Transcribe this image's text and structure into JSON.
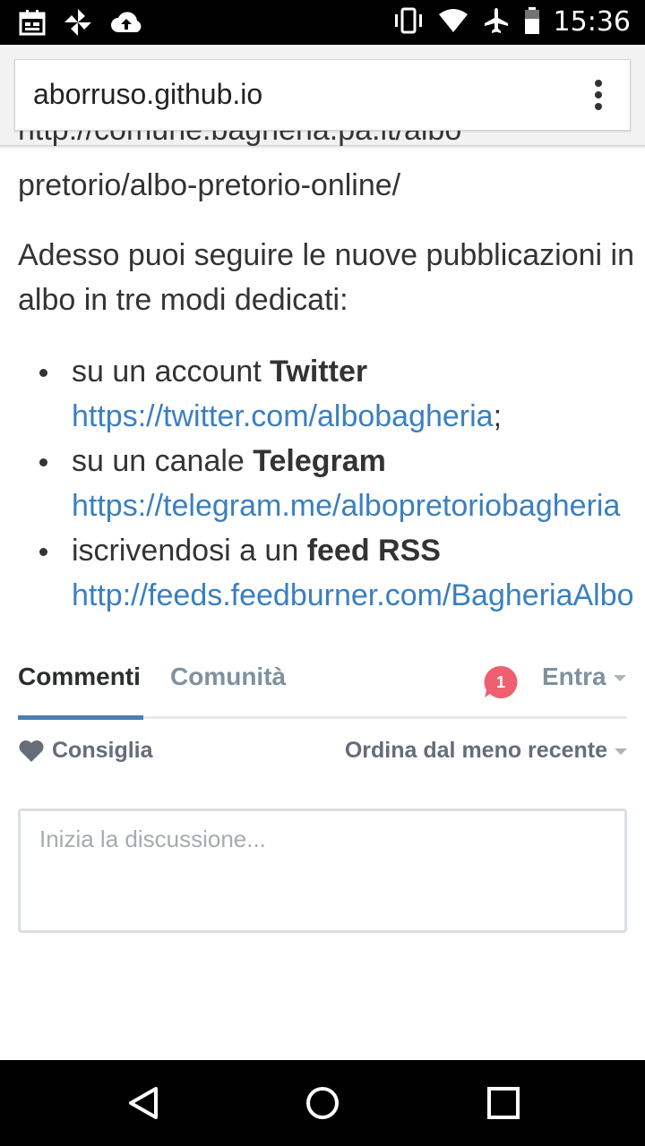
{
  "status_bar": {
    "time": "15:36",
    "left_icons": [
      "calendar-icon",
      "pinwheel-icon",
      "cloud-upload-icon"
    ],
    "right_icons": [
      "vibrate-icon",
      "wifi-icon",
      "airplane-icon",
      "battery-icon"
    ]
  },
  "browser": {
    "url": "aborruso.github.io"
  },
  "article": {
    "cut_off_line": "http://comune.bagheria.pa.it/albo",
    "line_pretorio": "pretorio/albo-pretorio-online/",
    "intro": "Adesso puoi seguire le nuove pubblicazioni in albo in tre modi dedicati:",
    "items": [
      {
        "prefix": "su un account ",
        "bold": "Twitter",
        "link": "https://twitter.com/albobagheria",
        "suffix": ";"
      },
      {
        "prefix": "su un canale ",
        "bold": "Telegram",
        "link": "https://telegram.me/albopretoriobagheria",
        "suffix": ""
      },
      {
        "prefix": "iscrivendosi a un ",
        "bold": "feed RSS",
        "link": "http://feeds.feedburner.com/BagheriaAlbo",
        "suffix": ""
      }
    ]
  },
  "comments": {
    "tab_active": "Commenti",
    "tab_community": "Comunità",
    "notification_count": "1",
    "login": "Entra",
    "recommend": "Consiglia",
    "sort": "Ordina dal meno recente",
    "input_placeholder": "Inizia la discussione..."
  },
  "colors": {
    "link": "#3a7fc1",
    "tab_underline": "#4a7fb5",
    "notification": "#f05f70"
  }
}
